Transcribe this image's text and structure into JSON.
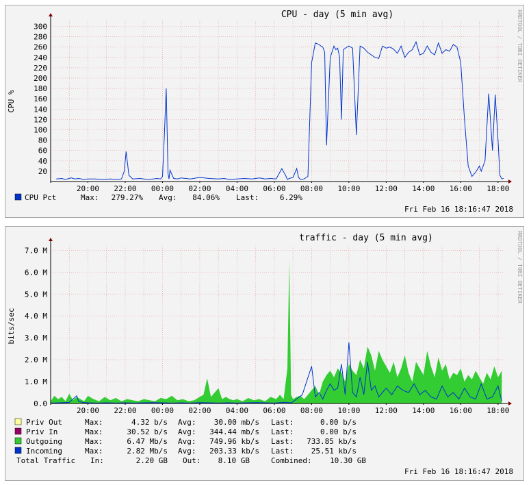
{
  "chart_data": [
    {
      "type": "line",
      "title": "CPU - day (5 min avg)",
      "ylabel": "CPU %",
      "watermark": "RRDTOOL / TOBI OETIKER",
      "timestamp": "Fri Feb 16 18:16:47 2018",
      "ylim": [
        0,
        300
      ],
      "yticks": [
        "300",
        "280",
        "260",
        "240",
        "220",
        "200",
        "180",
        "160",
        "140",
        "120",
        "100",
        "80",
        "60",
        "40",
        "20"
      ],
      "xticks": [
        "20:00",
        "22:00",
        "00:00",
        "02:00",
        "04:00",
        "06:00",
        "08:00",
        "10:00",
        "12:00",
        "14:00",
        "16:00",
        "18:00"
      ],
      "grid": true,
      "colors": {
        "cpu": "#0033cc",
        "grid": "#e8a8a8",
        "axis": "#000000",
        "arrow": "#800000"
      },
      "series": [
        {
          "name": "CPU Pct",
          "color": "#0033cc",
          "x_hours": [
            18.3,
            18.6,
            18.8,
            19.1,
            19.3,
            19.5,
            19.8,
            20.0,
            20.4,
            20.8,
            21.2,
            21.6,
            21.8,
            21.95,
            22.05,
            22.2,
            22.4,
            22.8,
            23.2,
            23.5,
            23.7,
            23.9,
            24.0,
            24.1,
            24.2,
            24.3,
            24.35,
            24.4,
            24.6,
            24.8,
            25.0,
            25.5,
            26.0,
            26.5,
            27.0,
            27.3,
            27.6,
            28.0,
            28.4,
            28.8,
            29.2,
            29.5,
            29.8,
            30.1,
            30.4,
            30.6,
            30.7,
            30.8,
            31.0,
            31.2,
            31.3,
            31.4,
            31.6,
            31.8,
            31.9,
            32.0,
            32.2,
            32.4,
            32.5,
            32.6,
            32.7,
            32.8,
            33.0,
            33.2,
            33.3,
            33.4,
            33.5,
            33.6,
            33.7,
            33.9,
            34.0,
            34.2,
            34.4,
            34.6,
            34.8,
            35.0,
            35.2,
            35.4,
            35.6,
            35.8,
            36.0,
            36.2,
            36.4,
            36.6,
            36.8,
            37.0,
            37.2,
            37.4,
            37.6,
            37.8,
            38.0,
            38.2,
            38.4,
            38.6,
            38.8,
            39.0,
            39.2,
            39.4,
            39.6,
            39.8,
            40.0,
            40.2,
            40.4,
            40.6,
            40.8,
            41.0,
            41.1,
            41.3,
            41.5,
            41.7,
            41.85,
            42.0,
            42.1,
            42.2,
            42.3
          ],
          "values": [
            5,
            6,
            4,
            7,
            5,
            6,
            4,
            5,
            5,
            4,
            5,
            4,
            5,
            20,
            58,
            12,
            5,
            6,
            4,
            5,
            6,
            5,
            10,
            90,
            180,
            15,
            5,
            22,
            6,
            5,
            7,
            5,
            8,
            6,
            5,
            6,
            4,
            5,
            6,
            5,
            7,
            5,
            6,
            5,
            25,
            12,
            4,
            6,
            8,
            25,
            8,
            4,
            5,
            10,
            120,
            230,
            268,
            265,
            262,
            260,
            250,
            70,
            240,
            262,
            255,
            258,
            240,
            120,
            255,
            260,
            262,
            258,
            90,
            262,
            258,
            250,
            245,
            240,
            238,
            262,
            258,
            260,
            256,
            248,
            262,
            240,
            250,
            255,
            270,
            245,
            248,
            262,
            250,
            245,
            268,
            248,
            255,
            252,
            265,
            260,
            230,
            120,
            30,
            10,
            18,
            30,
            20,
            40,
            170,
            60,
            168,
            80,
            12,
            5,
            6.29
          ]
        }
      ],
      "legend": {
        "label": "CPU Pct",
        "max": "279.27%",
        "avg": "84.06%",
        "last": "6.29%"
      },
      "legend_words": {
        "max": "Max:",
        "avg": "Avg:",
        "last": "Last:"
      }
    },
    {
      "type": "area",
      "title": "traffic - day (5 min avg)",
      "ylabel": "bits/sec",
      "watermark": "RRDTOOL / TOBI OETIKER",
      "timestamp": "Fri Feb 16 18:16:47 2018",
      "ylim": [
        0,
        7.0
      ],
      "yunit": "M",
      "yticks": [
        "7.0 M",
        "6.0 M",
        "5.0 M",
        "4.0 M",
        "3.0 M",
        "2.0 M",
        "1.0 M",
        "0.0"
      ],
      "xticks": [
        "20:00",
        "22:00",
        "00:00",
        "02:00",
        "04:00",
        "06:00",
        "08:00",
        "10:00",
        "12:00",
        "14:00",
        "16:00",
        "18:00"
      ],
      "grid": true,
      "colors": {
        "outgoing": "#33cc33",
        "incoming": "#0033cc",
        "priv_out": "#ffff99",
        "priv_in": "#990066",
        "grid": "#e8a8a8"
      },
      "series": [
        {
          "name": "Outgoing",
          "color": "#33cc33",
          "x_hours": [
            18.0,
            18.2,
            18.4,
            18.6,
            18.8,
            19.0,
            19.2,
            19.4,
            19.6,
            19.8,
            20.0,
            20.3,
            20.6,
            20.9,
            21.2,
            21.5,
            21.8,
            22.1,
            22.4,
            22.7,
            23.0,
            23.3,
            23.6,
            23.9,
            24.2,
            24.5,
            24.8,
            25.1,
            25.4,
            25.7,
            26.0,
            26.2,
            26.4,
            26.6,
            26.8,
            27.0,
            27.2,
            27.4,
            27.6,
            27.8,
            28.0,
            28.3,
            28.6,
            28.9,
            29.2,
            29.5,
            29.8,
            30.1,
            30.3,
            30.5,
            30.7,
            30.8,
            30.9,
            31.0,
            31.2,
            31.4,
            31.6,
            31.8,
            32.0,
            32.2,
            32.4,
            32.6,
            32.8,
            33.0,
            33.2,
            33.4,
            33.6,
            33.8,
            34.0,
            34.2,
            34.4,
            34.6,
            34.8,
            35.0,
            35.2,
            35.4,
            35.6,
            35.8,
            36.0,
            36.2,
            36.4,
            36.6,
            36.8,
            37.0,
            37.2,
            37.4,
            37.6,
            37.8,
            38.0,
            38.2,
            38.4,
            38.6,
            38.8,
            39.0,
            39.2,
            39.4,
            39.6,
            39.8,
            40.0,
            40.2,
            40.4,
            40.6,
            40.8,
            41.0,
            41.2,
            41.4,
            41.6,
            41.8,
            42.0,
            42.2
          ],
          "values": [
            0.1,
            0.35,
            0.2,
            0.3,
            0.1,
            0.45,
            0.15,
            0.3,
            0.2,
            0.1,
            0.35,
            0.2,
            0.1,
            0.3,
            0.15,
            0.25,
            0.1,
            0.2,
            0.15,
            0.1,
            0.2,
            0.15,
            0.1,
            0.25,
            0.2,
            0.35,
            0.15,
            0.2,
            0.1,
            0.15,
            0.3,
            0.4,
            1.15,
            0.3,
            0.5,
            0.7,
            0.2,
            0.3,
            0.2,
            0.15,
            0.2,
            0.1,
            0.25,
            0.15,
            0.2,
            0.1,
            0.3,
            0.2,
            0.4,
            0.2,
            1.6,
            6.5,
            0.4,
            0.2,
            0.3,
            0.35,
            0.2,
            0.4,
            0.6,
            0.8,
            0.4,
            1.0,
            1.3,
            1.5,
            1.2,
            1.6,
            1.4,
            1.0,
            1.8,
            1.5,
            1.3,
            2.0,
            1.6,
            2.6,
            2.2,
            1.5,
            2.4,
            2.0,
            1.7,
            1.4,
            1.9,
            1.2,
            1.6,
            2.2,
            1.4,
            1.0,
            1.9,
            1.6,
            1.3,
            2.4,
            1.7,
            1.2,
            2.1,
            1.5,
            1.8,
            1.1,
            1.4,
            1.3,
            1.6,
            1.0,
            1.3,
            1.1,
            1.5,
            1.2,
            0.9,
            1.4,
            1.1,
            1.7,
            1.2,
            1.5,
            0.8
          ]
        },
        {
          "name": "Incoming",
          "color": "#0033cc",
          "x_hours": [
            18.0,
            18.5,
            19.0,
            19.4,
            19.5,
            19.7,
            20.0,
            20.5,
            21.0,
            21.5,
            22.0,
            22.5,
            23.0,
            23.5,
            24.0,
            24.5,
            25.0,
            25.5,
            26.0,
            26.5,
            27.0,
            27.5,
            28.0,
            28.5,
            29.0,
            29.5,
            30.0,
            30.5,
            30.9,
            31.0,
            31.5,
            32.0,
            32.2,
            32.4,
            32.6,
            32.8,
            33.0,
            33.2,
            33.4,
            33.6,
            33.8,
            34.0,
            34.2,
            34.4,
            34.6,
            34.8,
            35.0,
            35.2,
            35.4,
            35.6,
            35.8,
            36.0,
            36.3,
            36.6,
            36.9,
            37.2,
            37.5,
            37.8,
            38.1,
            38.4,
            38.7,
            39.0,
            39.3,
            39.6,
            39.9,
            40.2,
            40.5,
            40.8,
            41.1,
            41.4,
            41.7,
            42.0,
            42.2
          ],
          "values": [
            0.02,
            0.03,
            0.05,
            0.35,
            0.1,
            0.05,
            0.03,
            0.02,
            0.03,
            0.02,
            0.03,
            0.02,
            0.03,
            0.04,
            0.03,
            0.02,
            0.03,
            0.02,
            0.04,
            0.03,
            0.02,
            0.03,
            0.02,
            0.03,
            0.04,
            0.03,
            0.02,
            0.05,
            0.03,
            0.08,
            0.4,
            1.7,
            0.3,
            0.5,
            0.2,
            0.6,
            0.9,
            0.6,
            0.7,
            1.8,
            0.4,
            2.8,
            0.5,
            0.3,
            1.2,
            0.4,
            1.9,
            0.6,
            0.8,
            0.3,
            0.5,
            0.7,
            0.4,
            0.8,
            0.6,
            0.5,
            0.9,
            0.4,
            0.6,
            0.3,
            0.2,
            0.8,
            0.3,
            0.5,
            0.2,
            0.7,
            0.3,
            0.2,
            0.9,
            0.2,
            0.3,
            0.8,
            0.1
          ]
        }
      ],
      "legend": [
        {
          "label": "Priv Out",
          "max": "4.32  b/s",
          "avg": "30.00 mb/s",
          "last": "0.00  b/s",
          "color": "#ffff99"
        },
        {
          "label": "Priv In",
          "max": "30.52  b/s",
          "avg": "344.44 mb/s",
          "last": "0.00  b/s",
          "color": "#990066"
        },
        {
          "label": "Outgoing",
          "max": "6.47 Mb/s",
          "avg": "749.96 kb/s",
          "last": "733.85 kb/s",
          "color": "#33cc33"
        },
        {
          "label": "Incoming",
          "max": "2.82 Mb/s",
          "avg": "203.33 kb/s",
          "last": "25.51 kb/s",
          "color": "#0033cc"
        }
      ],
      "legend_words": {
        "max": "Max:",
        "avg": "Avg:",
        "last": "Last:"
      },
      "total": {
        "label": "Total Traffic",
        "in_label": "In:",
        "in": "2.20 GB",
        "out_label": "Out:",
        "out": "8.10 GB",
        "combined_label": "Combined:",
        "combined": "10.30 GB"
      }
    }
  ]
}
